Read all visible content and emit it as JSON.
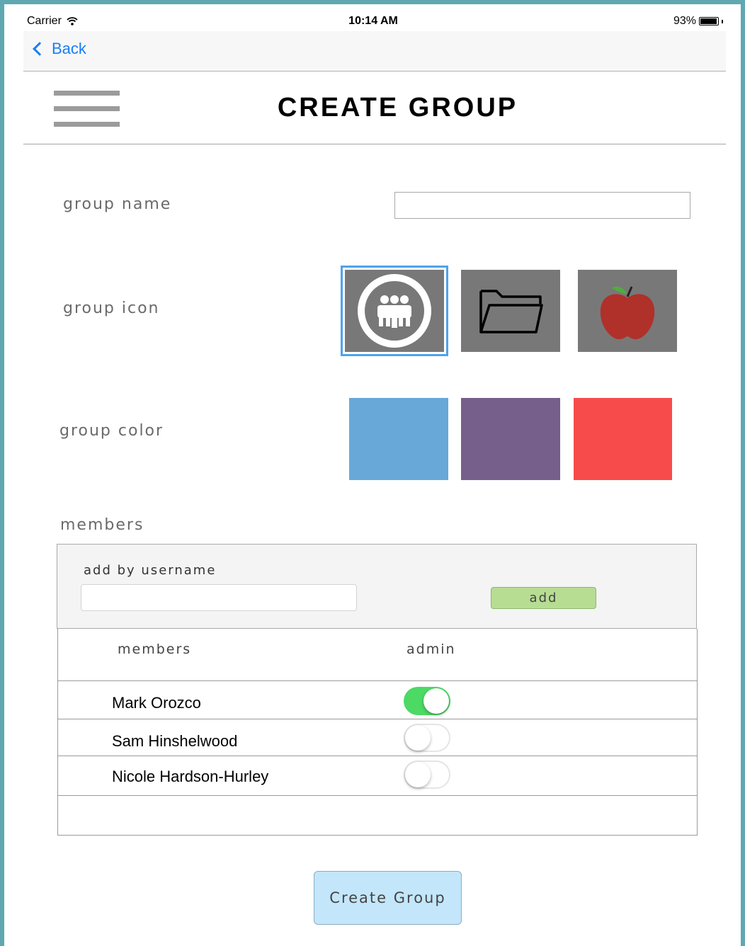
{
  "status_bar": {
    "carrier": "Carrier",
    "time": "10:14 AM",
    "battery": "93%"
  },
  "nav": {
    "back_label": "Back"
  },
  "header": {
    "title": "CREATE GROUP"
  },
  "form": {
    "group_name_label": "group name",
    "group_name_value": "",
    "group_icon_label": "group icon",
    "group_icons": [
      "people-icon",
      "folder-icon",
      "apple-icon"
    ],
    "selected_icon": "people-icon",
    "group_color_label": "group color",
    "group_colors": [
      "#67a8d9",
      "#765f8a",
      "#f74b4b"
    ]
  },
  "members_section": {
    "title": "members",
    "add_by_username_label": "add by username",
    "username_value": "",
    "add_button": "add",
    "table_headers": {
      "members": "members",
      "admin": "admin"
    },
    "rows": [
      {
        "name": "Mark Orozco",
        "admin": true
      },
      {
        "name": "Sam Hinshelwood",
        "admin": false
      },
      {
        "name": "Nicole Hardson-Hurley",
        "admin": false
      }
    ]
  },
  "create_button": "Create Group"
}
